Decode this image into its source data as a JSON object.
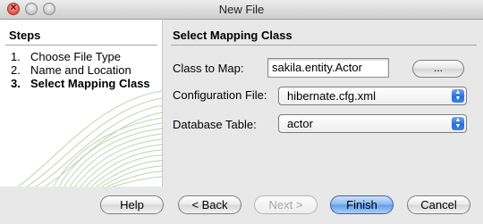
{
  "window": {
    "title": "New File"
  },
  "steps": {
    "title": "Steps",
    "items": [
      {
        "num": "1.",
        "label": "Choose File Type"
      },
      {
        "num": "2.",
        "label": "Name and Location"
      },
      {
        "num": "3.",
        "label": "Select Mapping Class"
      }
    ],
    "current_index": 2
  },
  "content": {
    "title": "Select Mapping Class",
    "class_to_map": {
      "label": "Class to Map:",
      "value": "sakila.entity.Actor",
      "browse_label": "..."
    },
    "configuration_file": {
      "label": "Configuration File:",
      "value": "hibernate.cfg.xml"
    },
    "database_table": {
      "label": "Database Table:",
      "value": "actor"
    }
  },
  "footer": {
    "help": "Help",
    "back": "< Back",
    "next": "Next >",
    "finish": "Finish",
    "cancel": "Cancel"
  },
  "colors": {
    "accent": "#2b6fd6",
    "decor": "#9fbf86"
  }
}
